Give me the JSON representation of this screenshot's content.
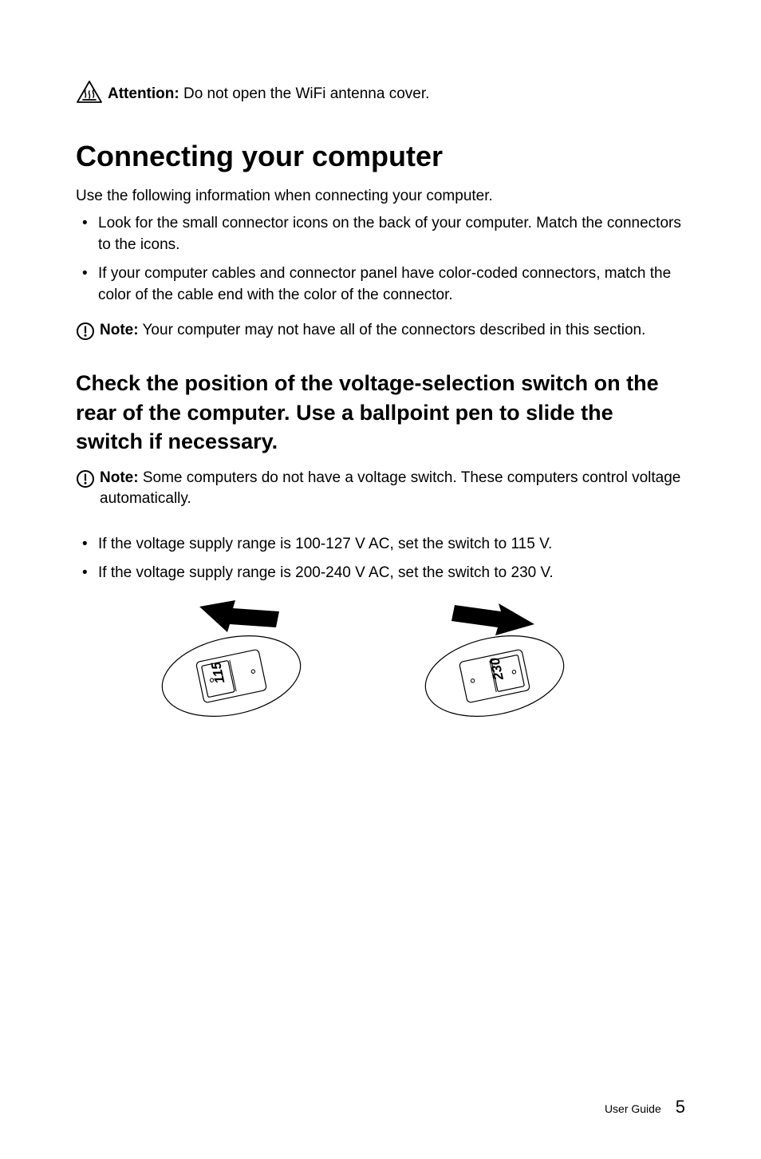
{
  "attention": {
    "label": "Attention:",
    "text": "Do not open the WiFi antenna cover."
  },
  "heading1": "Connecting your computer",
  "intro": "Use the following information when connecting your computer.",
  "bullets1": [
    "Look for the small connector icons on the back of your computer. Match the connectors to the icons.",
    "If your computer cables and connector panel have color-coded connectors, match the color of the cable end with the color of the connector."
  ],
  "note1": {
    "label": "Note:",
    "text": "Your computer may not have all of the connectors described in this section."
  },
  "heading2": "Check the position of the voltage-selection switch on the rear of the computer. Use a ballpoint pen to slide the switch if necessary.",
  "note2": {
    "label": "Note:",
    "text": "Some computers do not have a voltage switch. These computers control voltage automatically."
  },
  "bullets2": [
    "If the voltage supply range is 100-127 V AC, set the switch to 115 V.",
    "If the voltage supply range is 200-240 V AC, set the switch to 230 V."
  ],
  "switch_labels": {
    "left": "115",
    "right": "230"
  },
  "footer": {
    "label": "User Guide",
    "page": "5"
  }
}
